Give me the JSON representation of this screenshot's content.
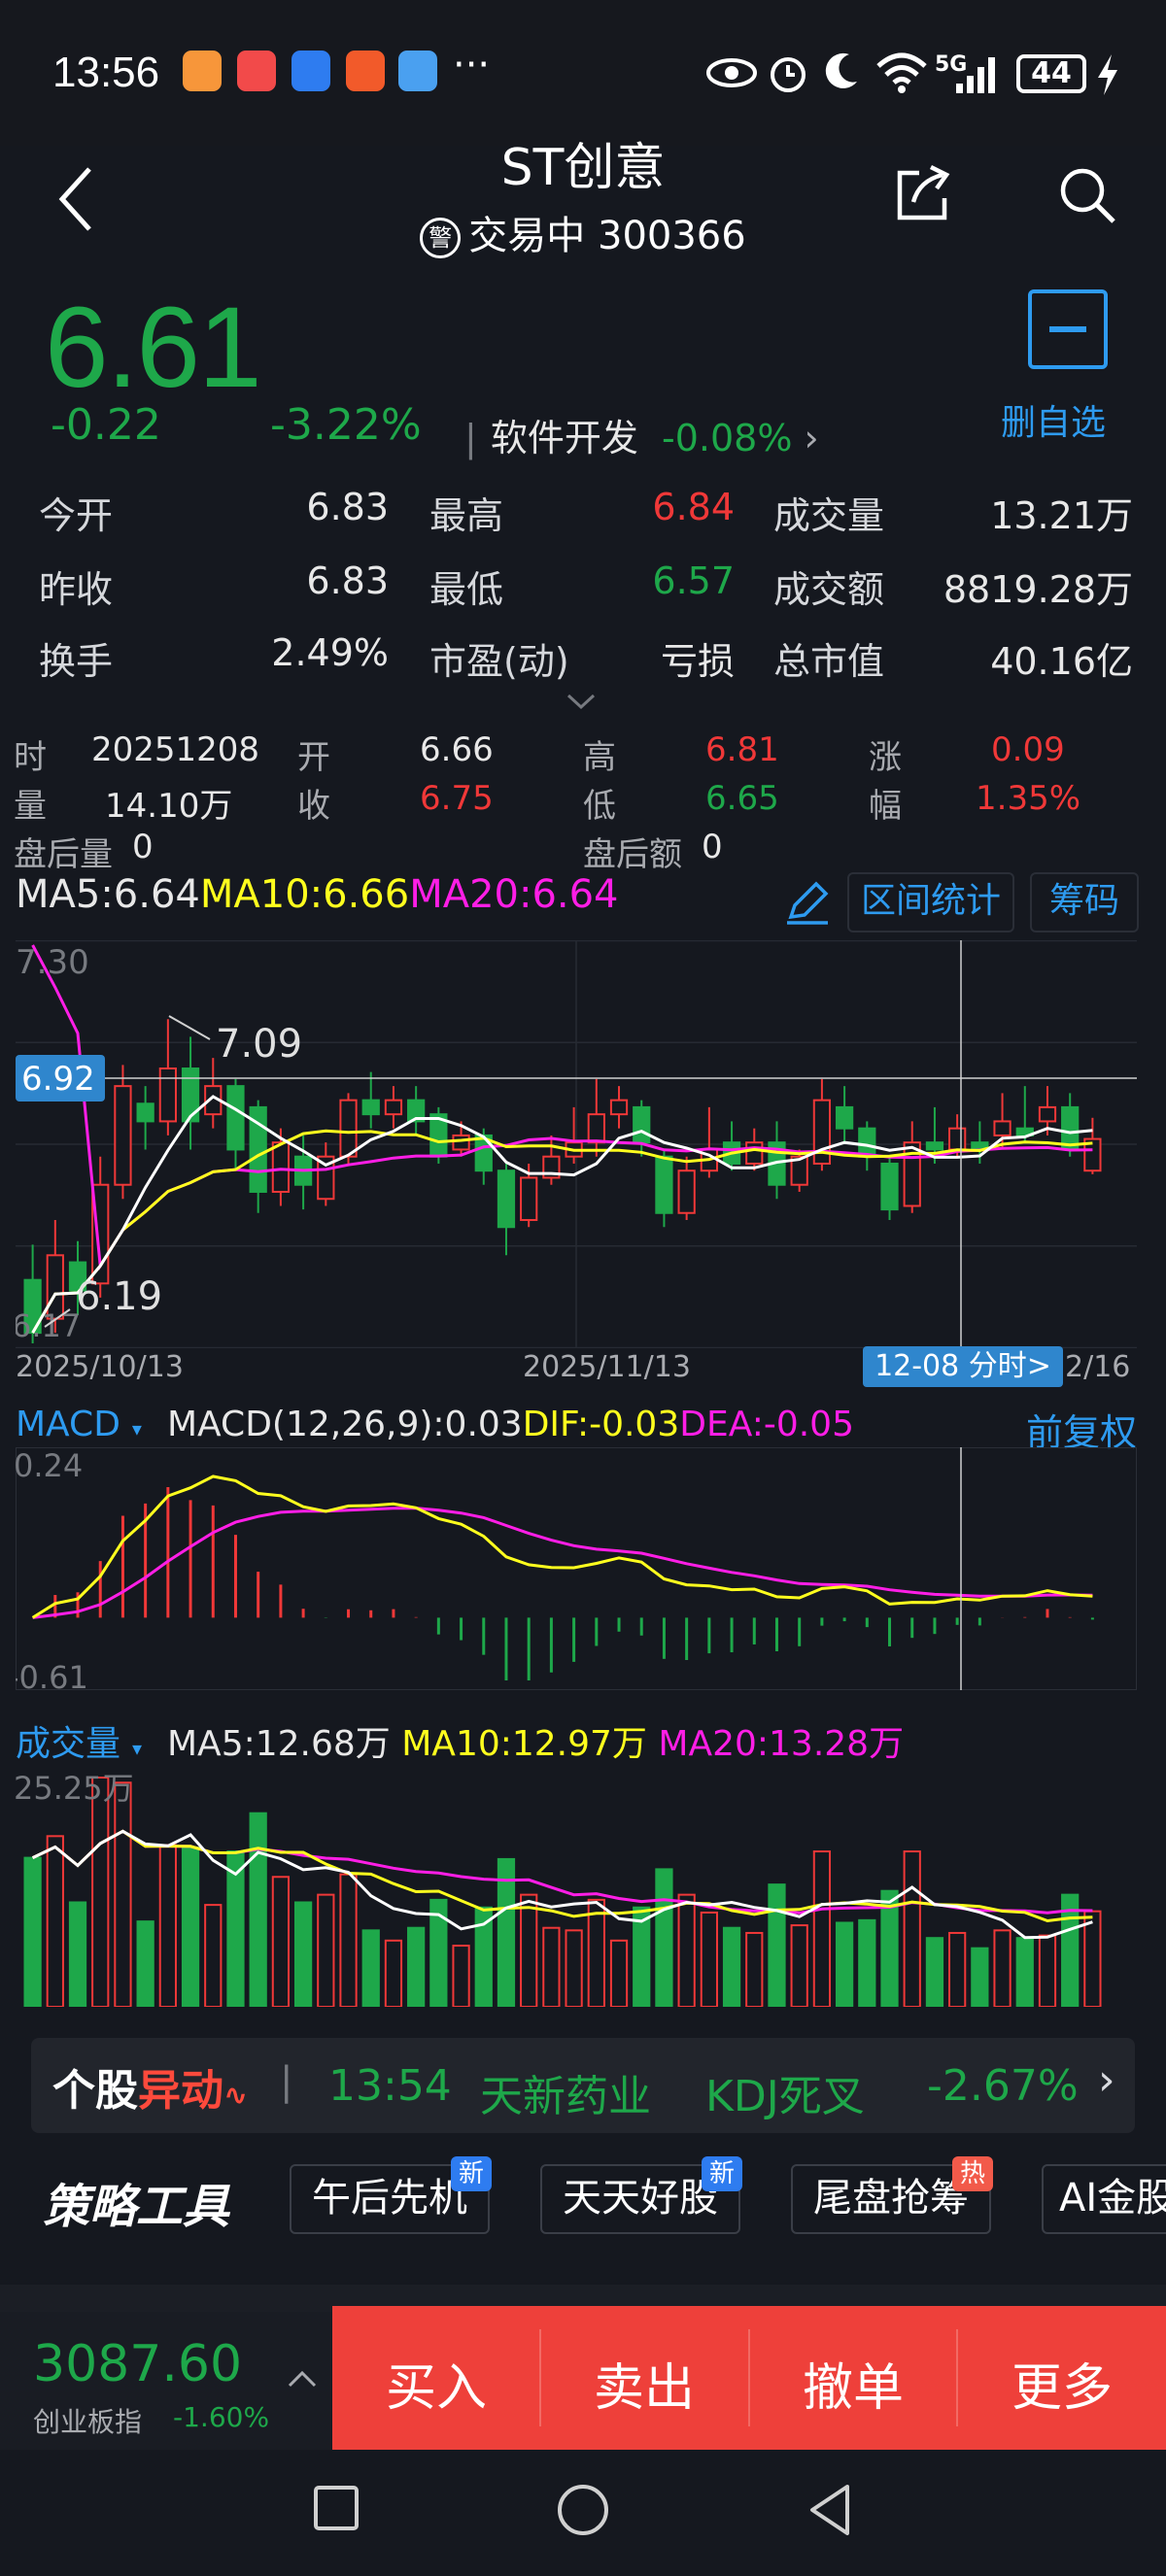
{
  "status_bar": {
    "time": "13:56",
    "more": "···",
    "network": "5G",
    "battery": "44"
  },
  "header": {
    "title": "ST创意",
    "warn_badge": "警",
    "status": "交易中",
    "code": "300366"
  },
  "quote": {
    "price": "6.61",
    "change": "-0.22",
    "change_pct": "-3.22%",
    "sector_name": "软件开发",
    "sector_pct": "-0.08%",
    "fav_label": "删自选",
    "rows": [
      [
        {
          "label": "今开",
          "value": "6.83",
          "color": "white"
        },
        {
          "label": "最高",
          "value": "6.84",
          "color": "red"
        },
        {
          "label": "成交量",
          "value": "13.21万",
          "color": "white"
        }
      ],
      [
        {
          "label": "昨收",
          "value": "6.83",
          "color": "white"
        },
        {
          "label": "最低",
          "value": "6.57",
          "color": "green"
        },
        {
          "label": "成交额",
          "value": "8819.28万",
          "color": "white"
        }
      ],
      [
        {
          "label": "换手",
          "value": "2.49%",
          "color": "white"
        },
        {
          "label": "市盈(动)",
          "value": "亏损",
          "color": "white"
        },
        {
          "label": "总市值",
          "value": "40.16亿",
          "color": "white"
        }
      ]
    ]
  },
  "day_info": {
    "time_label": "时",
    "date": "20251208",
    "open_label": "开",
    "open": "6.66",
    "high_label": "高",
    "high": "6.81",
    "rise_label": "涨",
    "rise": "0.09",
    "vol_label": "量",
    "vol": "14.10万",
    "close_label": "收",
    "close": "6.75",
    "low_label": "低",
    "low": "6.65",
    "amp_label": "幅",
    "amp": "1.35%",
    "after_vol_label": "盘后量",
    "after_vol": "0",
    "after_amt_label": "盘后额",
    "after_amt": "0"
  },
  "ma_legend": {
    "ma5": "MA5:6.64",
    "ma10": "MA10:6.66",
    "ma20": "MA20:6.64"
  },
  "buttons": {
    "range_stat": "区间统计",
    "chips": "筹码"
  },
  "kline_labels": {
    "top": "7.30",
    "bottom": "6.17",
    "cursor_price": "6.92",
    "max_mark": "7.09",
    "min_mark": "6.19",
    "date_left": "2025/10/13",
    "date_mid": "2025/11/13",
    "date_right": "2/16",
    "cursor_date": "12-08 分时>"
  },
  "macd": {
    "name": "MACD",
    "params": "MACD(12,26,9):0.03",
    "dif": "DIF:-0.03",
    "dea": "DEA:-0.05",
    "adjust": "前复权",
    "top": "0.24",
    "bottom": "-0.61"
  },
  "volume": {
    "name": "成交量",
    "ma5": "MA5:12.68万",
    "ma10": "MA10:12.97万",
    "ma20": "MA20:13.28万",
    "top": "25.25万"
  },
  "ticker": {
    "logo_a": "个股",
    "logo_b": "异动",
    "time": "13:54",
    "name": "天新药业",
    "signal": "KDJ死叉",
    "pct": "-2.67%"
  },
  "tools": {
    "logo": "策略工具",
    "items": [
      {
        "label": "午后先机",
        "tag": "新"
      },
      {
        "label": "天天好股",
        "tag": "新"
      },
      {
        "label": "尾盘抢筹",
        "tag": "热"
      },
      {
        "label": "AI金股",
        "tag": ""
      }
    ]
  },
  "bottom_bar": {
    "index_value": "3087.60",
    "index_name": "创业板指",
    "index_change": "-1.60%",
    "buy": "买入",
    "sell": "卖出",
    "cancel": "撤单",
    "more": "更多"
  },
  "colors": {
    "up": "#f03838",
    "down": "#1ea84a",
    "ma5": "#ffffff",
    "ma10": "#ffff1e",
    "ma20": "#ff1ee6",
    "accent": "#2e9bf0",
    "action_bar": "#ee403a"
  },
  "chart_data": {
    "type": "candlestick",
    "x_range": [
      "2025/10/13",
      "2025/12/16"
    ],
    "y_range": [
      6.17,
      7.3
    ],
    "candles": [
      {
        "o": 6.35,
        "c": 6.2,
        "h": 6.45,
        "l": 6.17
      },
      {
        "o": 6.24,
        "c": 6.42,
        "h": 6.52,
        "l": 6.2
      },
      {
        "o": 6.4,
        "c": 6.32,
        "h": 6.46,
        "l": 6.25
      },
      {
        "o": 6.34,
        "c": 6.62,
        "h": 6.7,
        "l": 6.3
      },
      {
        "o": 6.62,
        "c": 6.9,
        "h": 6.96,
        "l": 6.58
      },
      {
        "o": 6.85,
        "c": 6.8,
        "h": 6.9,
        "l": 6.72
      },
      {
        "o": 6.8,
        "c": 6.95,
        "h": 7.09,
        "l": 6.76
      },
      {
        "o": 6.95,
        "c": 6.8,
        "h": 7.04,
        "l": 6.72
      },
      {
        "o": 6.82,
        "c": 6.9,
        "h": 6.98,
        "l": 6.78
      },
      {
        "o": 6.9,
        "c": 6.72,
        "h": 6.92,
        "l": 6.66
      },
      {
        "o": 6.84,
        "c": 6.6,
        "h": 6.86,
        "l": 6.54
      },
      {
        "o": 6.6,
        "c": 6.74,
        "h": 6.78,
        "l": 6.56
      },
      {
        "o": 6.7,
        "c": 6.62,
        "h": 6.76,
        "l": 6.55
      },
      {
        "o": 6.58,
        "c": 6.7,
        "h": 6.74,
        "l": 6.56
      },
      {
        "o": 6.7,
        "c": 6.86,
        "h": 6.88,
        "l": 6.68
      },
      {
        "o": 6.86,
        "c": 6.82,
        "h": 6.94,
        "l": 6.78
      },
      {
        "o": 6.82,
        "c": 6.86,
        "h": 6.9,
        "l": 6.78
      },
      {
        "o": 6.86,
        "c": 6.8,
        "h": 6.9,
        "l": 6.76
      },
      {
        "o": 6.82,
        "c": 6.7,
        "h": 6.84,
        "l": 6.68
      },
      {
        "o": 6.72,
        "c": 6.76,
        "h": 6.8,
        "l": 6.7
      },
      {
        "o": 6.76,
        "c": 6.66,
        "h": 6.78,
        "l": 6.62
      },
      {
        "o": 6.66,
        "c": 6.5,
        "h": 6.68,
        "l": 6.42
      },
      {
        "o": 6.52,
        "c": 6.64,
        "h": 6.68,
        "l": 6.5
      },
      {
        "o": 6.64,
        "c": 6.7,
        "h": 6.76,
        "l": 6.62
      },
      {
        "o": 6.7,
        "c": 6.74,
        "h": 6.84,
        "l": 6.68
      },
      {
        "o": 6.74,
        "c": 6.82,
        "h": 6.92,
        "l": 6.7
      },
      {
        "o": 6.82,
        "c": 6.86,
        "h": 6.9,
        "l": 6.78
      },
      {
        "o": 6.84,
        "c": 6.74,
        "h": 6.86,
        "l": 6.7
      },
      {
        "o": 6.7,
        "c": 6.54,
        "h": 6.72,
        "l": 6.5
      },
      {
        "o": 6.54,
        "c": 6.66,
        "h": 6.7,
        "l": 6.52
      },
      {
        "o": 6.66,
        "c": 6.72,
        "h": 6.84,
        "l": 6.64
      },
      {
        "o": 6.74,
        "c": 6.68,
        "h": 6.8,
        "l": 6.66
      },
      {
        "o": 6.68,
        "c": 6.74,
        "h": 6.78,
        "l": 6.66
      },
      {
        "o": 6.74,
        "c": 6.62,
        "h": 6.8,
        "l": 6.58
      },
      {
        "o": 6.62,
        "c": 6.7,
        "h": 6.72,
        "l": 6.6
      },
      {
        "o": 6.68,
        "c": 6.86,
        "h": 6.92,
        "l": 6.66
      },
      {
        "o": 6.84,
        "c": 6.78,
        "h": 6.9,
        "l": 6.74
      },
      {
        "o": 6.78,
        "c": 6.7,
        "h": 6.8,
        "l": 6.66
      },
      {
        "o": 6.68,
        "c": 6.55,
        "h": 6.7,
        "l": 6.52
      },
      {
        "o": 6.56,
        "c": 6.74,
        "h": 6.8,
        "l": 6.54
      },
      {
        "o": 6.74,
        "c": 6.72,
        "h": 6.84,
        "l": 6.68
      },
      {
        "o": 6.72,
        "c": 6.78,
        "h": 6.82,
        "l": 6.7
      },
      {
        "o": 6.74,
        "c": 6.72,
        "h": 6.8,
        "l": 6.68
      },
      {
        "o": 6.76,
        "c": 6.8,
        "h": 6.88,
        "l": 6.72
      },
      {
        "o": 6.78,
        "c": 6.76,
        "h": 6.9,
        "l": 6.74
      },
      {
        "o": 6.8,
        "c": 6.84,
        "h": 6.9,
        "l": 6.76
      },
      {
        "o": 6.84,
        "c": 6.72,
        "h": 6.88,
        "l": 6.7
      },
      {
        "o": 6.66,
        "c": 6.75,
        "h": 6.81,
        "l": 6.65
      }
    ]
  }
}
